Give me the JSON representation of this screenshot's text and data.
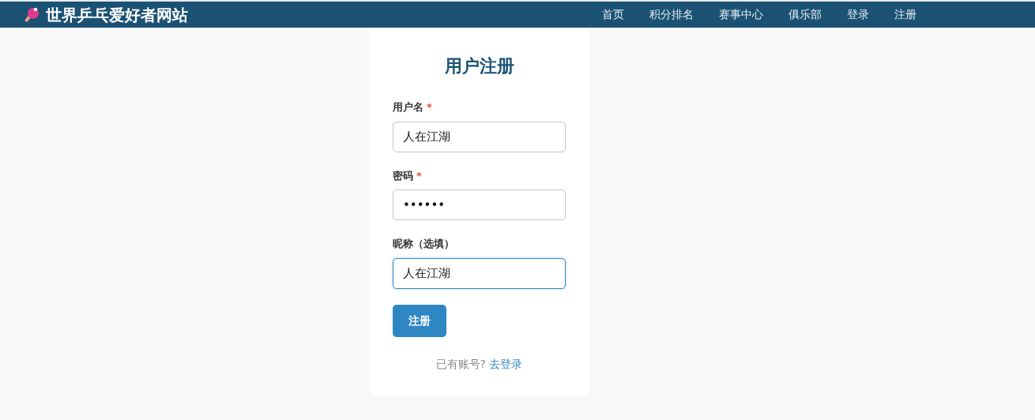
{
  "navbar": {
    "brand": "世界乒乓爱好者网站",
    "links": [
      {
        "label": "首页",
        "selected": false
      },
      {
        "label": "积分排名",
        "selected": false
      },
      {
        "label": "赛事中心",
        "selected": false
      },
      {
        "label": "俱乐部",
        "selected": false
      },
      {
        "label": "登录",
        "selected": false
      },
      {
        "label": "注册",
        "selected": false
      }
    ]
  },
  "form": {
    "title": "用户注册",
    "fields": [
      {
        "label": "用户名",
        "required_mark": "*",
        "value": "人在江湖",
        "focused": false
      },
      {
        "label": "密码",
        "required_mark": "*",
        "value": "••••••",
        "focused": false
      },
      {
        "label": "昵称（选填）",
        "value": "人在江湖",
        "focused": true
      }
    ],
    "submit": "注册",
    "footer_text": "已有账号?",
    "footer_link": "去登录"
  }
}
